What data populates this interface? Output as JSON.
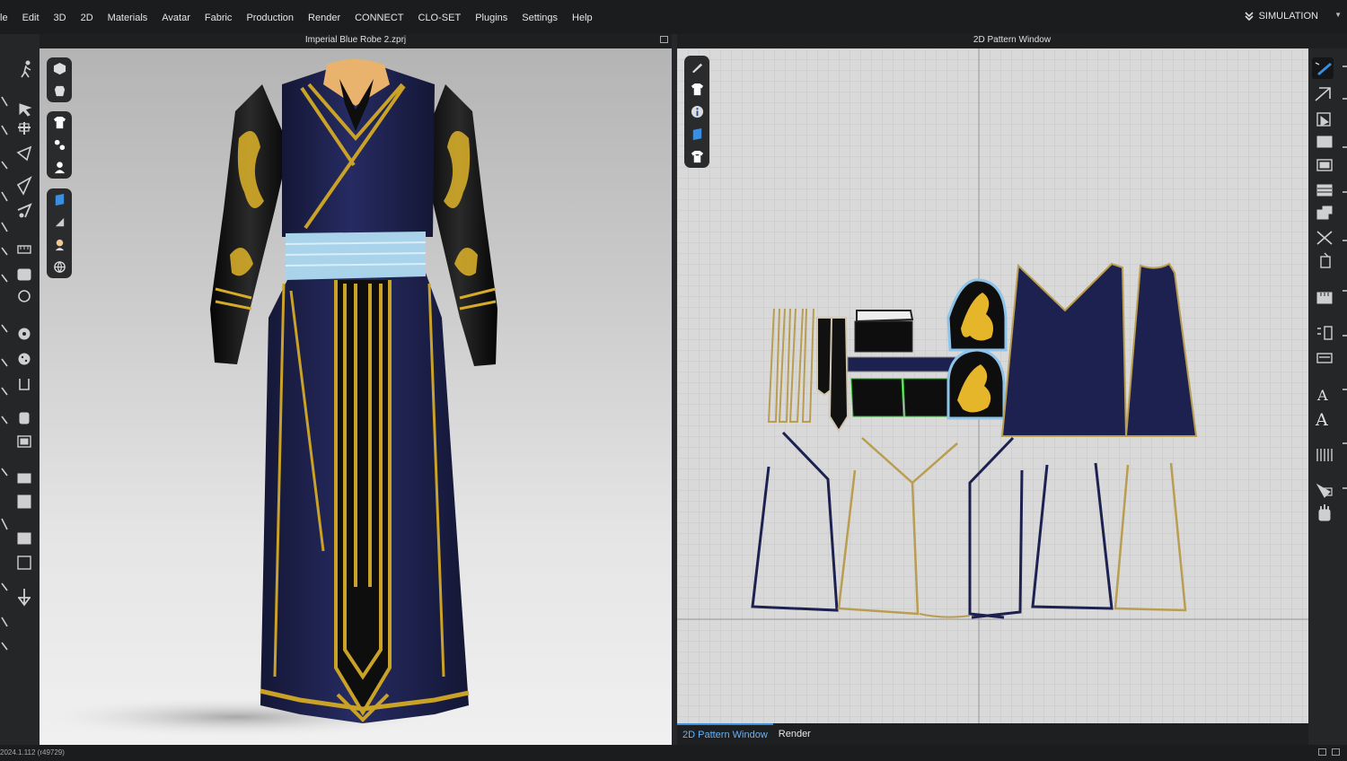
{
  "menu": {
    "items": [
      "le",
      "Edit",
      "3D",
      "2D",
      "Materials",
      "Avatar",
      "Fabric",
      "Production",
      "Render",
      "CONNECT",
      "CLO-SET",
      "Plugins",
      "Settings",
      "Help"
    ],
    "simulation_label": "SIMULATION"
  },
  "viewport3d": {
    "title": "Imperial Blue Robe 2.zprj"
  },
  "pattern_window": {
    "title": "2D Pattern Window"
  },
  "bottom_tabs": {
    "active": "2D Pattern Window",
    "render": "Render"
  },
  "status": {
    "version": "2024.1.112 (r49729)"
  },
  "colors": {
    "navy": "#1d2150",
    "gold": "#c9a227",
    "belt": "#a9d3ea",
    "black": "#0e0e0e",
    "collar": "#e9b36d",
    "accent_blue": "#3a8fe0"
  },
  "icons": {
    "left_toolbar": [
      "walking-avatar-icon",
      "select-move-icon",
      "transform-icon",
      "edit-pattern-icon",
      "fold-icon",
      "pin-icon",
      "measure-icon",
      "tack-icon",
      "button-icon",
      "buttonhole-icon",
      "zipper-icon",
      "elastic-icon",
      "texture-icon",
      "graphic-icon",
      "arrange-icon",
      "layer-icon",
      "fit-icon"
    ],
    "floating_3d": [
      "cube-icon",
      "avatar-body-icon",
      "shirt-icon",
      "points-icon",
      "person-icon",
      "fabric-swatch-icon",
      "texture-ball-icon",
      "avatar-bust-icon",
      "globe-icon"
    ],
    "floating_2d": [
      "pen-tool-icon",
      "shirt-icon",
      "info-icon",
      "fabric-swatch-icon",
      "garment-icon"
    ],
    "right_toolbar": [
      "select-icon",
      "transform-icon",
      "internal-shape-icon",
      "rectangle-icon",
      "circle-icon",
      "grid-icon",
      "trace-icon",
      "cut-icon",
      "segment-icon",
      "ruler-icon",
      "text-icon",
      "annotation-icon",
      "notch-icon",
      "pleat-icon",
      "sewing-icon"
    ]
  }
}
